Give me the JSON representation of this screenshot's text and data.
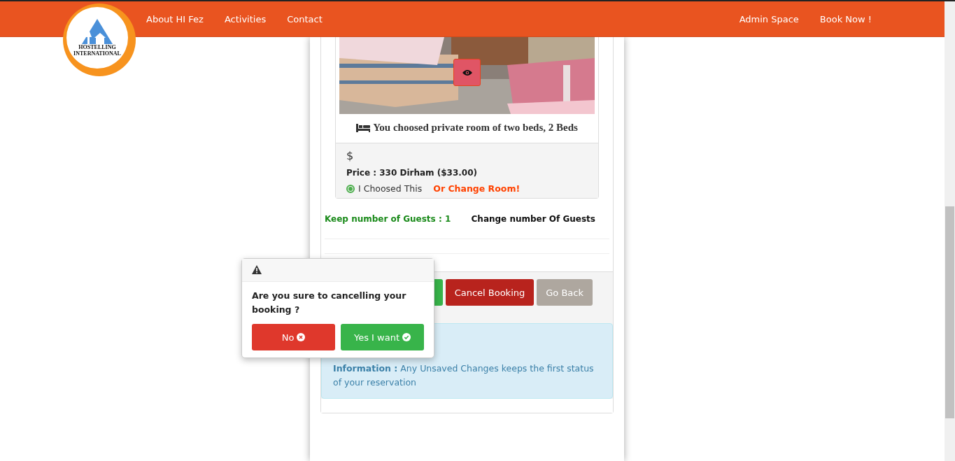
{
  "logo": {
    "lines": [
      "HOSTELLING",
      "INTERNATIONAL"
    ]
  },
  "nav": {
    "left": [
      {
        "label": "About HI Fez"
      },
      {
        "label": "Activities"
      },
      {
        "label": "Contact"
      }
    ],
    "right": [
      {
        "label": "Admin Space"
      },
      {
        "label": "Book Now !"
      }
    ]
  },
  "room": {
    "kind": "picture",
    "title": "You choosed private room of two beds, 2 Beds",
    "currency": "$",
    "price": "Price : 330 Dirham ($33.00)",
    "choice": {
      "label": "I Choosed This",
      "selected": true
    },
    "change_link": "Or Change Room!"
  },
  "guests": {
    "keep": "Keep number of Guests : 1",
    "change": "Change number Of Guests"
  },
  "actions": [
    {
      "label": "Cancel Booking",
      "kind": "danger"
    },
    {
      "label": "Go Back",
      "kind": "muted"
    }
  ],
  "info": "**Information :** Any Unsaved Changes keeps the first status of your reservation",
  "popover": {
    "question": "Are you sure to cancelling your booking ?",
    "buttons": [
      {
        "label": "No",
        "kind": "no"
      },
      {
        "label": "Yes I want",
        "kind": "yes"
      }
    ]
  }
}
